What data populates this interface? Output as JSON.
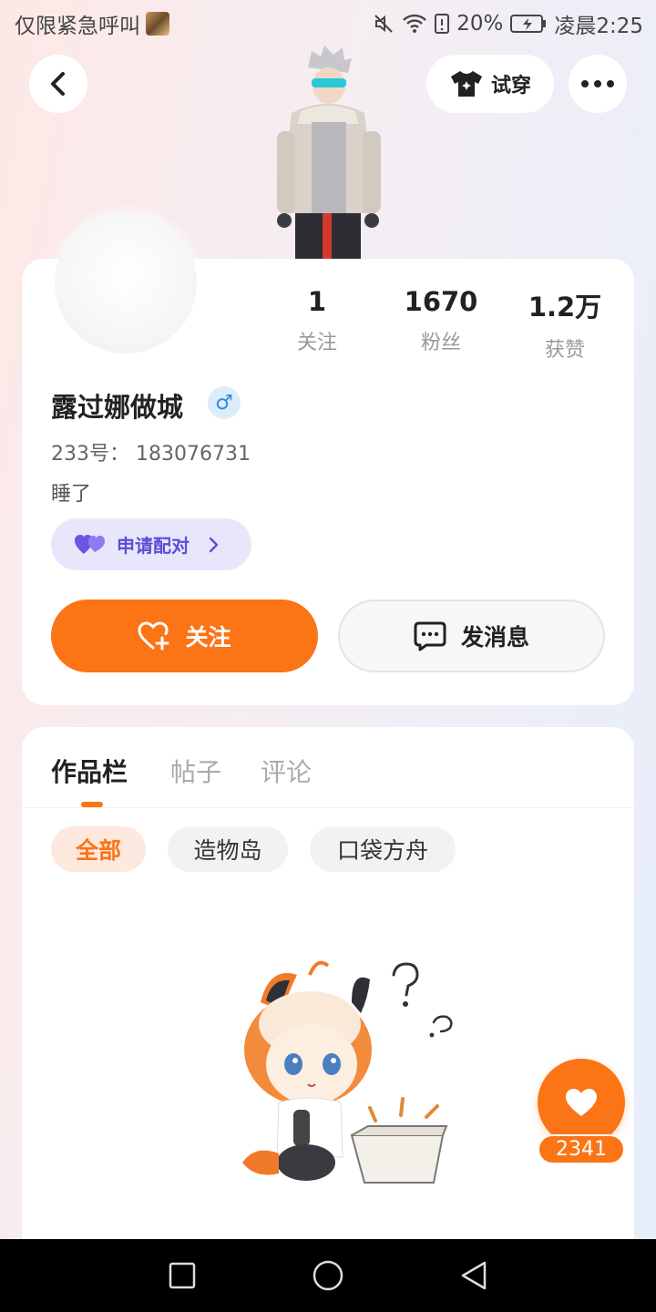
{
  "status_bar": {
    "left_text": "仅限紧急呼叫",
    "battery_percent": "20%",
    "time": "凌晨2:25"
  },
  "header": {
    "back_icon": "chevron-left-icon",
    "tryon_label": "试穿",
    "more_icon": "more-dots-icon"
  },
  "profile": {
    "stats": [
      {
        "value": "1",
        "label": "关注"
      },
      {
        "value": "1670",
        "label": "粉丝"
      },
      {
        "value": "1.2万",
        "label": "获赞"
      }
    ],
    "username": "露过娜做城",
    "gender_symbol": "♂",
    "uid": "233号： 183076731",
    "bio": "睡了",
    "match_label": "申请配对",
    "follow_label": "关注",
    "message_label": "发消息"
  },
  "content": {
    "tabs": [
      {
        "label": "作品栏",
        "active": true
      },
      {
        "label": "帖子",
        "active": false
      },
      {
        "label": "评论",
        "active": false
      }
    ],
    "filters": [
      {
        "label": "全部",
        "active": true
      },
      {
        "label": "造物岛",
        "active": false
      },
      {
        "label": "口袋方舟",
        "active": false
      }
    ]
  },
  "like_fab": {
    "count": "2341"
  },
  "colors": {
    "accent": "#fb7416",
    "match_purple": "#5e4dd6",
    "gender_blue": "#2f8be3"
  }
}
